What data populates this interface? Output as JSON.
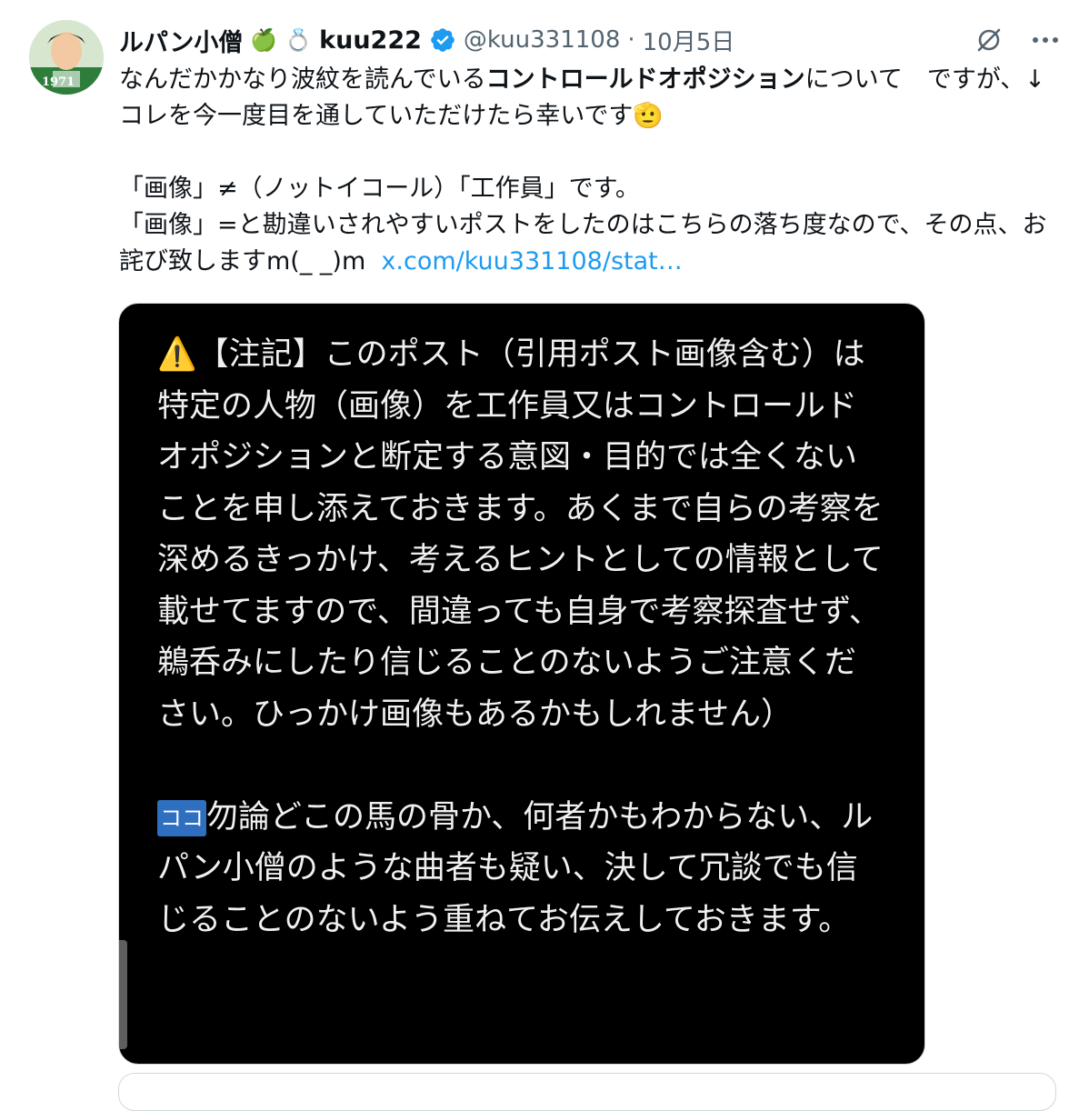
{
  "author": {
    "display_name": "ルパン小僧",
    "emoji_1": "🍏",
    "emoji_2": "💍",
    "display_name_suffix": "kuu222",
    "handle": "@kuu331108",
    "separator": "·",
    "date": "10月5日",
    "avatar_caption": "1971"
  },
  "tweet": {
    "text_part1": "なんだかかなり波紋を読んでいる",
    "text_bold": "コントロールドオポジション",
    "text_part2": "について　ですが、↓コレを今一度目を通していただけたら幸いです🫡\n\n「画像」≠（ノットイコール）「工作員」です。\n「画像」=と勘違いされやすいポストをしたのはこちらの落ち度なので、その点、お詫び致しますm(_ _)m  ",
    "link_text": "x.com/kuu331108/stat…"
  },
  "media": {
    "warning_icon": "⚠️",
    "paragraph_1": "【注記】このポスト（引用ポスト画像含む）は特定の人物（画像）を工作員又はコントロールドオポジションと断定する意図・目的では全くないことを申し添えておきます。あくまで自らの考察を深めるきっかけ、考えるヒントとしての情報として載せてますので、間違っても自身で考察探査せず、鵜呑みにしたり信じることのないようご注意ください。ひっかけ画像もあるかもしれません）",
    "koko_badge": "ココ",
    "paragraph_2": "勿論どこの馬の骨か、何者かもわからない、ルパン小僧のような曲者も疑い、決して冗談でも信じることのないよう重ねてお伝えしておきます。"
  },
  "colors": {
    "link": "#1d9bf0",
    "verified": "#1d9bf0",
    "secondary_text": "#536471",
    "media_bg": "#000000"
  },
  "icons": [
    "grok-icon",
    "more-icon",
    "verified-badge-icon",
    "warning-icon"
  ]
}
